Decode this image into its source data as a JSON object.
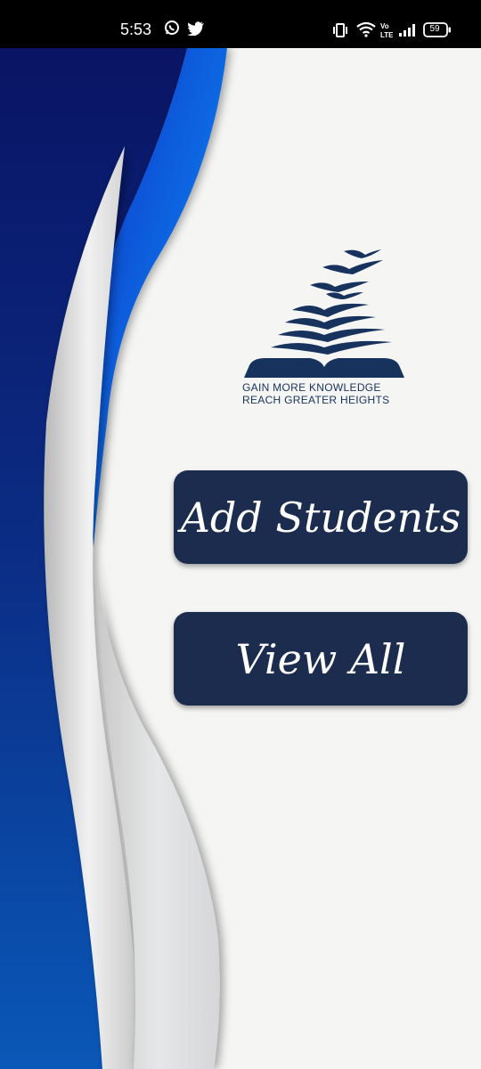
{
  "status_bar": {
    "time": "5:53",
    "battery": "59",
    "icons": [
      "whatsapp-icon",
      "twitter-icon",
      "vibrate-icon",
      "wifi-icon",
      "volte-icon",
      "signal-icon",
      "battery-icon"
    ]
  },
  "logo": {
    "line1": "GAIN MORE KNOWLEDGE",
    "line2": "REACH GREATER HEIGHTS",
    "color": "#17325c"
  },
  "actions": {
    "add_label": "Add Students",
    "view_label": "View All"
  },
  "colors": {
    "button_bg": "#1c2c4e",
    "wave_dark": "#0a1f6e",
    "wave_light": "#0d6be0",
    "panel_bg": "#f5f5f4"
  }
}
